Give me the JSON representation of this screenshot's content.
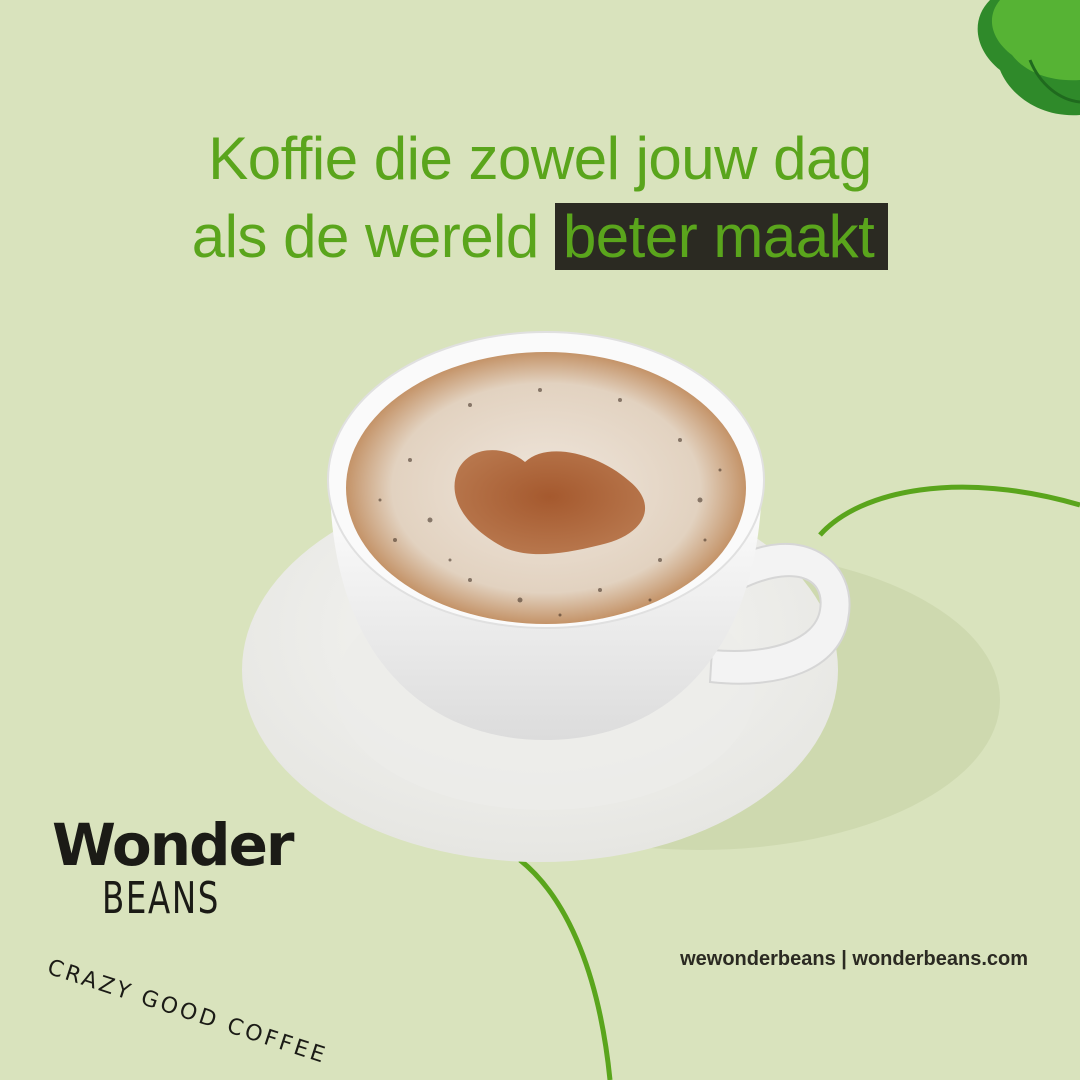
{
  "headline": {
    "line1": "Koffie die zowel jouw dag",
    "line2_plain": "als de wereld",
    "line2_highlight": "beter maakt"
  },
  "logo": {
    "word1": "Wonder",
    "word2": "BEANS",
    "tagline": "CRAZY GOOD COFFEE"
  },
  "footer": {
    "handles": "wewonderbeans | wonderbeans.com"
  },
  "colors": {
    "background": "#d9e3bd",
    "accent_green": "#5aa51c",
    "highlight_bg": "#2b2a22",
    "text_dark": "#1b1b16"
  },
  "icons": [
    "leaf-icon",
    "coffee-cup-icon",
    "heart-latte-icon"
  ]
}
